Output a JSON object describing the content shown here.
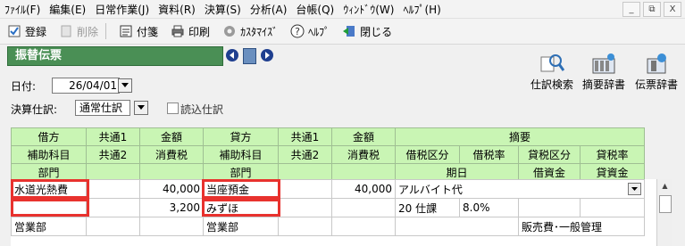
{
  "menu": [
    "ﾌｧｲﾙ(F)",
    "編集(E)",
    "日常作業(J)",
    "資料(R)",
    "決算(S)",
    "分析(A)",
    "台帳(Q)",
    "ｳｨﾝﾄﾞｳ(W)",
    "ﾍﾙﾌﾟ(H)"
  ],
  "window_controls": [
    "_",
    "⧉",
    "X"
  ],
  "toolbar": {
    "register": "登録",
    "delete": "削除",
    "memo": "付箋",
    "print": "印刷",
    "customize": "ｶｽﾀﾏｲｽﾞ",
    "help": "ﾍﾙﾌﾟ",
    "close": "閉じる"
  },
  "panel_title": "振替伝票",
  "right_tools": [
    "仕訳検索",
    "摘要辞書",
    "伝票辞書"
  ],
  "form": {
    "date_label": "日付:",
    "date_value": "26/04/01",
    "settle_label": "決算仕訳:",
    "settle_value": "通常仕訳",
    "readin_label": "読込仕訳"
  },
  "header": {
    "row1": [
      "借方",
      "共通1",
      "金額",
      "貸方",
      "共通1",
      "金額",
      "摘要"
    ],
    "row2": [
      "補助科目",
      "共通2",
      "消費税",
      "補助科目",
      "共通2",
      "消費税",
      "借税区分",
      "借税率",
      "貸税区分",
      "貸税率"
    ],
    "row3": [
      "部門",
      "部門",
      "期日",
      "借資金",
      "貸資金"
    ]
  },
  "rows": [
    {
      "debit": "水道光熱費",
      "debit_amount": "40,000",
      "credit": "当座預金",
      "credit_amount": "40,000",
      "summary": "アルバイト代"
    },
    {
      "debit_sub": "",
      "debit_tax": "3,200",
      "credit_sub": "みずほ",
      "tax_code": "20 仕課",
      "tax_rate": "8.0%"
    },
    {
      "debit_dept": "営業部",
      "credit_dept": "営業部",
      "fund": "販売費･一般管理"
    }
  ],
  "colors": {
    "title_bg": "#4a8f55",
    "header_bg": "#c9f5b4",
    "highlight": "#e8322e",
    "nav": "#1f3f8f"
  }
}
